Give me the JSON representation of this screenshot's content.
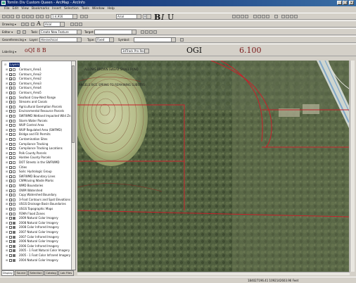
{
  "window": {
    "title": "Tomlin Div Custom Queen - ArcMap - ArcInfo",
    "controls": [
      "_",
      "□",
      "×"
    ]
  },
  "menu": [
    "File",
    "Edit",
    "View",
    "Bookmarks",
    "Insert",
    "Selection",
    "Tools",
    "Window",
    "Help"
  ],
  "toolbar1": {
    "scale_value": "1:4,916",
    "font_value": "Arial",
    "font_size": "8",
    "bold": "B",
    "italic": "I",
    "underline": "U"
  },
  "toolbar2": {
    "drawing_label": "Drawing ▾",
    "zoom_symbol": "A",
    "arial_value": "Arial"
  },
  "toolbar3": {
    "editor_label": "Editor ▾",
    "task_label": "Task:",
    "task_value": "Create New Feature",
    "target_label": "Target:",
    "target_value": ""
  },
  "toolbar4": {
    "georef_label": "Georeferencing ▾",
    "layer_label": "Layer:",
    "layer_value": "Hierarchical",
    "type_label": "Type:",
    "type_value": "Fixed",
    "symbol_label": "Symbol:"
  },
  "toolbar5": {
    "labeling_label": "Labeling ▾",
    "tracking_value": "3dTrack Pro Ready",
    "glyphs_a": "oQI 8 B",
    "glyphs_b": "OGI",
    "glyphs_c": "6.100"
  },
  "toc": {
    "root_label": "Layers",
    "layers": [
      {
        "name": "Contours_Area1",
        "checked": true,
        "swatch": "empty"
      },
      {
        "name": "Contours_Area2",
        "checked": true,
        "swatch": "empty"
      },
      {
        "name": "Contours_Area2",
        "checked": true,
        "swatch": "empty"
      },
      {
        "name": "Contours_Area3",
        "checked": false,
        "swatch": "empty"
      },
      {
        "name": "Contours_Area4",
        "checked": false,
        "swatch": "empty"
      },
      {
        "name": "Contours_Area5",
        "checked": false,
        "swatch": "empty"
      },
      {
        "name": "Seafood Crow-Nest Range",
        "checked": false,
        "swatch": "empty"
      },
      {
        "name": "Streams and Canals",
        "checked": false,
        "swatch": "empty"
      },
      {
        "name": "Agricultural Exemption Parcels",
        "checked": false,
        "swatch": "empty"
      },
      {
        "name": "Environmental Resource Parcels",
        "checked": false,
        "swatch": "empty"
      },
      {
        "name": "SWFWMD Wetland Impacted Wild Zn",
        "checked": false,
        "swatch": "empty"
      },
      {
        "name": "Storm Water Parcels",
        "checked": false,
        "swatch": "empty"
      },
      {
        "name": "WUP Control Area",
        "checked": false,
        "swatch": "empty"
      },
      {
        "name": "WUP Regulated Area (SWFMD)",
        "checked": false,
        "swatch": "empty"
      },
      {
        "name": "Bridge and Fill Permits",
        "checked": false,
        "swatch": "empty"
      },
      {
        "name": "Contamination Sites",
        "checked": false,
        "swatch": "empty"
      },
      {
        "name": "Compliance Tracking",
        "checked": false,
        "swatch": "empty"
      },
      {
        "name": "Compliance Tracking Locations",
        "checked": false,
        "swatch": "empty"
      },
      {
        "name": "Polk County Parcels",
        "checked": false,
        "swatch": "empty"
      },
      {
        "name": "Hardee County Parcels",
        "checked": false,
        "swatch": "empty"
      },
      {
        "name": "DOT Streets in the SWFWMD",
        "checked": false,
        "swatch": "empty"
      },
      {
        "name": "Cities",
        "checked": false,
        "swatch": "empty"
      },
      {
        "name": "Soils: Hydrologic Group",
        "checked": false,
        "swatch": "empty"
      },
      {
        "name": "SWFWMD Boundary Lines",
        "checked": false,
        "swatch": "empty"
      },
      {
        "name": "CWM/using Waste Marks",
        "checked": false,
        "swatch": "empty"
      },
      {
        "name": "WMD Boundaries",
        "checked": false,
        "swatch": "empty"
      },
      {
        "name": "OWM Watershed",
        "checked": false,
        "swatch": "empty"
      },
      {
        "name": "Copy Watershed Boundary",
        "checked": false,
        "swatch": "empty"
      },
      {
        "name": "3-Foot Contours and Spot Elevations",
        "checked": false,
        "swatch": "empty"
      },
      {
        "name": "USGS Drainage Basin Boundaries",
        "checked": false,
        "swatch": "empty"
      },
      {
        "name": "USGS Topographic Maps",
        "checked": false,
        "swatch": "empty"
      },
      {
        "name": "FEMA Flood Zones",
        "checked": false,
        "swatch": "empty"
      },
      {
        "name": "2009 Natural Color Imagery",
        "checked": false,
        "swatch": "fill"
      },
      {
        "name": "2008 Natural Color Imagery",
        "checked": false,
        "swatch": "fill"
      },
      {
        "name": "2008 Color Infrared Imagery",
        "checked": false,
        "swatch": "fill"
      },
      {
        "name": "2007 Natural Color Imagery",
        "checked": false,
        "swatch": "fill"
      },
      {
        "name": "2007 Color Infrared Imagery",
        "checked": false,
        "swatch": "fill"
      },
      {
        "name": "2006 Natural Color Imagery",
        "checked": false,
        "swatch": "fill"
      },
      {
        "name": "2006 Color Infrared Imagery",
        "checked": false,
        "swatch": "fill"
      },
      {
        "name": "2005 - 1 Foot Natural Color Imagery",
        "checked": false,
        "swatch": "fill"
      },
      {
        "name": "2005 - 1 Foot Color Infrared Imagery",
        "checked": false,
        "swatch": "fill"
      },
      {
        "name": "2004 Natural Color Imagery",
        "checked": false,
        "swatch": "fill"
      }
    ]
  },
  "tabs": [
    "Display",
    "Source",
    "Selection",
    "Catalog",
    "Lab Files"
  ],
  "map": {
    "label_1": "ALLOWS BROWN SWEAR SMALL POND",
    "label_2": "ANGELS RICE SPRING TO REMAINING SUBSTRS"
  },
  "status": {
    "coordinates": "184027196.41  1092142603.96 Feet"
  },
  "colors": {
    "title_bar": "#0a246a",
    "parcel_line": "#c8202a",
    "road": "#7fa6c8"
  }
}
